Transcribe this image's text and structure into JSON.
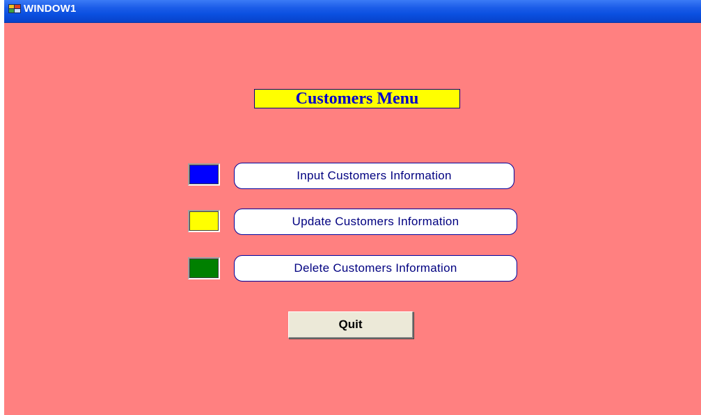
{
  "window": {
    "title": "WINDOW1",
    "background": "#ff8080"
  },
  "heading": {
    "text": "Customers Menu",
    "background": "#ffff00",
    "color": "#0000cc"
  },
  "menu": {
    "items": [
      {
        "label": "Input Customers Information",
        "swatch_color": "#0000ff"
      },
      {
        "label": "Update Customers Information",
        "swatch_color": "#ffff00"
      },
      {
        "label": "Delete Customers Information",
        "swatch_color": "#008000"
      }
    ]
  },
  "quit": {
    "label": "Quit"
  },
  "icons": {
    "app": "app-window-icon"
  }
}
